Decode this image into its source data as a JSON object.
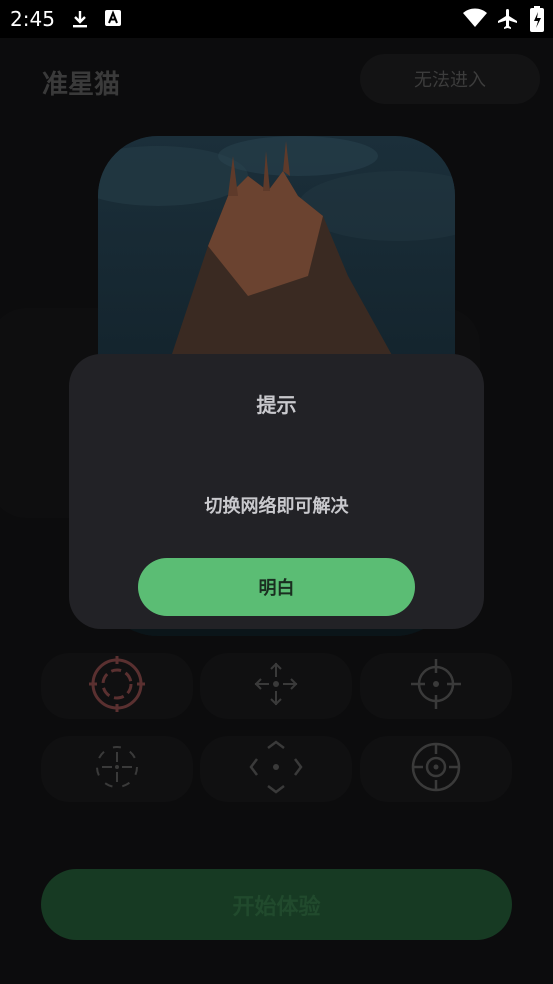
{
  "status_bar": {
    "time": "2:45",
    "icons": [
      "download-icon",
      "a-notification-icon",
      "wifi-icon",
      "airplane-icon",
      "battery-charging-icon"
    ]
  },
  "header": {
    "app_title": "准星猫",
    "cant_enter_label": "无法进入"
  },
  "crosshair_grid": {
    "items": [
      {
        "icon": "crosshair-circle-red-icon"
      },
      {
        "icon": "crosshair-arrows-icon"
      },
      {
        "icon": "crosshair-circle-dot-icon"
      },
      {
        "icon": "crosshair-dashed-icon"
      },
      {
        "icon": "crosshair-diamond-icon"
      },
      {
        "icon": "crosshair-scope-icon"
      }
    ]
  },
  "start_button_label": "开始体验",
  "dialog": {
    "title": "提示",
    "message": "切换网络即可解决",
    "ok_label": "明白"
  },
  "colors": {
    "accent_green": "#5bbd74",
    "dialog_bg": "#222226",
    "crosshair_red": "#5a3030"
  }
}
